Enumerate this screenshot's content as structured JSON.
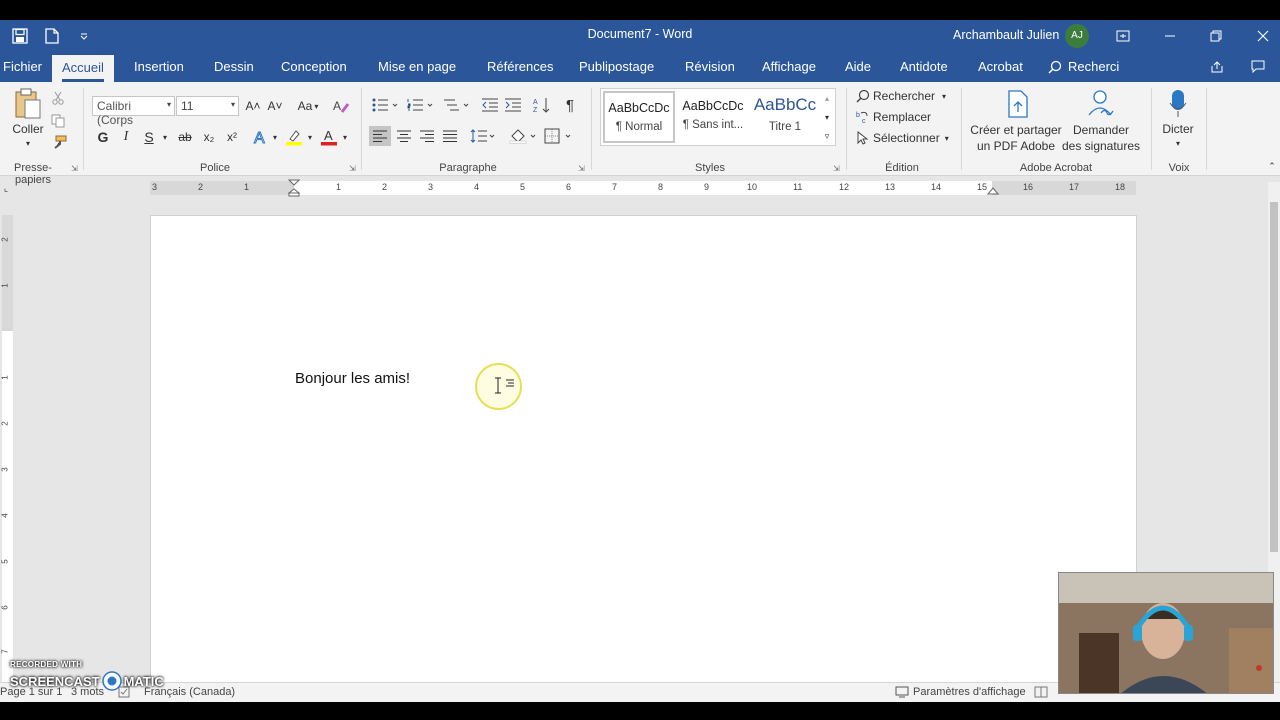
{
  "window": {
    "title": "Document7  -  Word",
    "user_name": "Archambault Julien",
    "user_initials": "AJ"
  },
  "tabs": [
    "Fichier",
    "Accueil",
    "Insertion",
    "Dessin",
    "Conception",
    "Mise en page",
    "Références",
    "Publipostage",
    "Révision",
    "Affichage",
    "Aide",
    "Antidote",
    "Acrobat"
  ],
  "active_tab": "Accueil",
  "search": {
    "placeholder": "Recherci"
  },
  "ribbon": {
    "clipboard": {
      "paste_label": "Coller",
      "group_label": "Presse-papiers"
    },
    "font": {
      "font_name": "Calibri (Corps",
      "font_size": "11",
      "bold": "G",
      "italic": "I",
      "underline": "S",
      "strike": "ab",
      "subscript": "x₂",
      "superscript": "x²",
      "grow": "A˄",
      "shrink": "A˅",
      "case": "Aa",
      "group_label": "Police"
    },
    "paragraph": {
      "pilcrow": "¶",
      "group_label": "Paragraphe"
    },
    "styles": {
      "items": [
        {
          "sample": "AaBbCcDc",
          "name": "¶ Normal"
        },
        {
          "sample": "AaBbCcDc",
          "name": "¶ Sans int..."
        },
        {
          "sample": "AaBbCс",
          "name": "Titre 1"
        }
      ],
      "group_label": "Styles"
    },
    "editing": {
      "find": "Rechercher",
      "replace": "Remplacer",
      "select": "Sélectionner",
      "group_label": "Édition"
    },
    "adobe": {
      "create_pdf_line1": "Créer et partager",
      "create_pdf_line2": "un PDF Adobe",
      "request_sig_line1": "Demander",
      "request_sig_line2": "des signatures",
      "group_label": "Adobe Acrobat"
    },
    "voice": {
      "dictate": "Dicter",
      "group_label": "Voix"
    }
  },
  "ruler": {
    "labels": [
      "3",
      "2",
      "1",
      "1",
      "2",
      "3",
      "4",
      "5",
      "6",
      "7",
      "8",
      "9",
      "10",
      "11",
      "12",
      "13",
      "14",
      "15",
      "16",
      "17",
      "18"
    ],
    "vertical_labels": [
      "2",
      "1",
      "1",
      "2",
      "3",
      "4",
      "5",
      "6",
      "7"
    ]
  },
  "document": {
    "text": "Bonjour les amis!"
  },
  "status": {
    "page": "Page 1 sur 1",
    "words": "3 mots",
    "language": "Français (Canada)",
    "display_settings": "Paramètres d'affichage"
  },
  "watermark": {
    "line1": "RECORDED WITH",
    "line2_a": "SCREENCAST",
    "line2_b": "MATIC"
  },
  "colors": {
    "brand": "#2b579a",
    "ribbon_bg": "#f3f3f3",
    "font_color": "#e02020",
    "highlight": "#ffff00"
  }
}
